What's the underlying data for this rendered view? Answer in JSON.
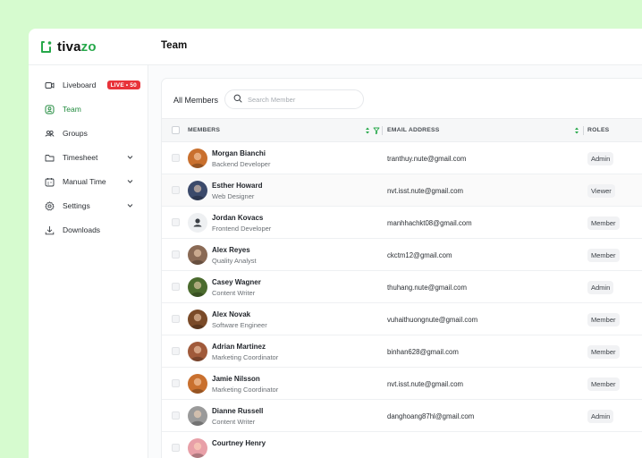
{
  "brand": {
    "name_prefix": "tiva",
    "name_suffix": "zo",
    "accent": "#26a84a"
  },
  "header": {
    "title": "Team"
  },
  "sidebar": {
    "items": [
      {
        "label": "Liveboard",
        "icon": "camera-icon",
        "badge": "LIVE • 50"
      },
      {
        "label": "Team",
        "icon": "user-circle-icon",
        "active": true
      },
      {
        "label": "Groups",
        "icon": "users-icon"
      },
      {
        "label": "Timesheet",
        "icon": "folder-icon",
        "expandable": true
      },
      {
        "label": "Manual Time",
        "icon": "calendar-icon",
        "expandable": true
      },
      {
        "label": "Settings",
        "icon": "gear-icon",
        "expandable": true
      },
      {
        "label": "Downloads",
        "icon": "download-icon"
      }
    ]
  },
  "members": {
    "tab_label": "All Members",
    "search_placeholder": "Search Member",
    "columns": {
      "members": "MEMBERS",
      "email": "EMAIL ADDRESS",
      "roles": "ROLES"
    },
    "rows": [
      {
        "name": "Morgan Bianchi",
        "title": "Backend Developer",
        "email": "tranthuy.nute@gmail.com",
        "role": "Admin",
        "avatar": "#c9702e"
      },
      {
        "name": "Esther Howard",
        "title": "Web Designer",
        "email": "nvt.isst.nute@gmail.com",
        "role": "Viewer",
        "avatar": "#3b4a6b"
      },
      {
        "name": "Jordan Kovacs",
        "title": "Frontend Developer",
        "email": "manhhachkt08@gmail.com",
        "role": "Member",
        "avatar": "placeholder"
      },
      {
        "name": "Alex Reyes",
        "title": "Quality Analyst",
        "email": "ckctm12@gmail.com",
        "role": "Member",
        "avatar": "#8a6a55"
      },
      {
        "name": "Casey Wagner",
        "title": "Content Writer",
        "email": "thuhang.nute@gmail.com",
        "role": "Admin",
        "avatar": "#4b6b2e"
      },
      {
        "name": "Alex Novak",
        "title": "Software Engineer",
        "email": "vuhaithuongnute@gmail.com",
        "role": "Member",
        "avatar": "#7a4a28"
      },
      {
        "name": "Adrian Martinez",
        "title": "Marketing Coordinator",
        "email": "binhan628@gmail.com",
        "role": "Member",
        "avatar": "#a05a3a"
      },
      {
        "name": "Jamie Nilsson",
        "title": "Marketing Coordinator",
        "email": "nvt.isst.nute@gmail.com",
        "role": "Member",
        "avatar": "#c9702e"
      },
      {
        "name": "Dianne Russell",
        "title": "Content Writer",
        "email": "danghoang87hl@gmail.com",
        "role": "Admin",
        "avatar": "#9a9a9a"
      },
      {
        "name": "Courtney Henry",
        "title": "",
        "email": "",
        "role": "",
        "avatar": "#e8a0a8"
      }
    ]
  }
}
